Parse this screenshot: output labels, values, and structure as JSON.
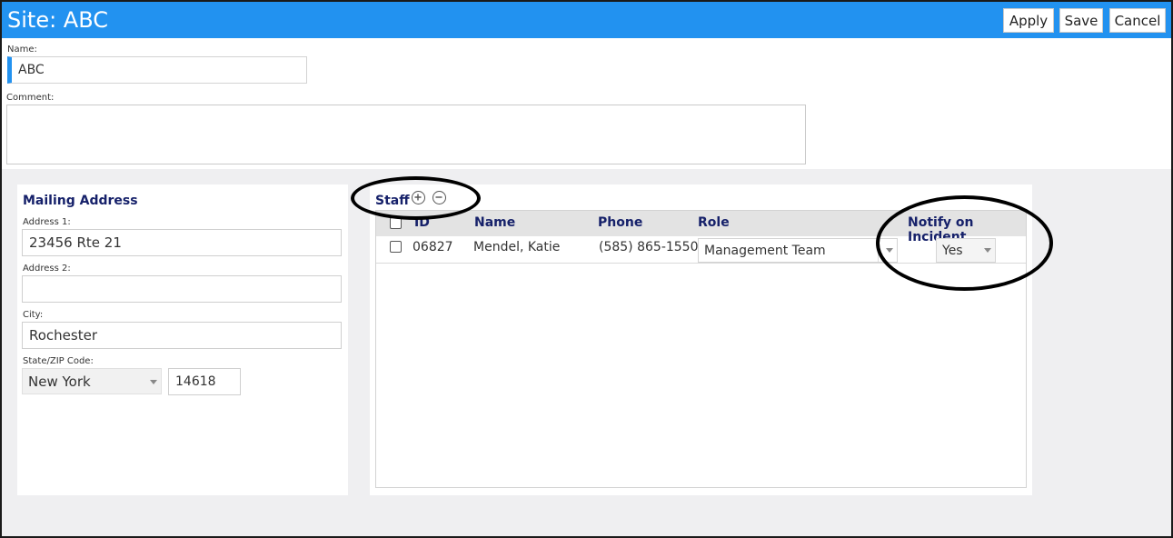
{
  "header": {
    "title": "Site: ABC",
    "apply_label": "Apply",
    "save_label": "Save",
    "cancel_label": "Cancel",
    "accent_color": "#2292f0"
  },
  "form": {
    "name_label": "Name:",
    "name_value": "ABC",
    "comment_label": "Comment:",
    "comment_value": ""
  },
  "mailing": {
    "title": "Mailing Address",
    "address1_label": "Address 1:",
    "address1_value": "23456 Rte 21",
    "address2_label": "Address 2:",
    "address2_value": "",
    "city_label": "City:",
    "city_value": "Rochester",
    "statezip_label": "State/ZIP Code:",
    "state_value": "New York",
    "zip_value": "14618"
  },
  "staff": {
    "title": "Staff",
    "add_icon": "plus-circle-icon",
    "remove_icon": "minus-circle-icon",
    "columns": {
      "id": "ID",
      "name": "Name",
      "phone": "Phone",
      "role": "Role",
      "notify": "Notify on Incident"
    },
    "rows": [
      {
        "id": "06827",
        "name": "Mendel, Katie",
        "phone": "(585) 865-1550",
        "role": "Management Team",
        "notify": "Yes"
      }
    ]
  }
}
